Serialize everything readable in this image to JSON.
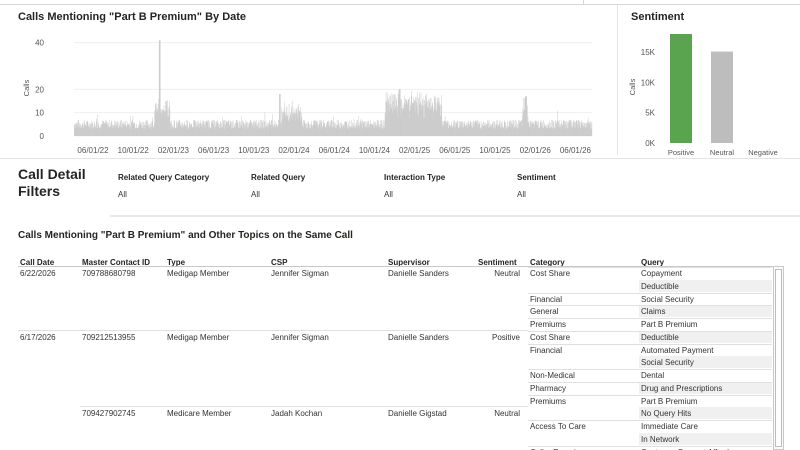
{
  "date_chart": {
    "title": "Calls Mentioning \"Part B Premium\" By Date",
    "ylabel": "Calls",
    "y_ticks": [
      "40",
      "20",
      "10",
      "0"
    ],
    "x_ticks": [
      "06/01/22",
      "10/01/22",
      "02/01/23",
      "06/01/23",
      "10/01/23",
      "02/01/24",
      "06/01/24",
      "10/01/24",
      "02/01/25",
      "06/01/25",
      "10/01/25",
      "02/01/26",
      "06/01/26"
    ],
    "bar_color": "#c8c8c8"
  },
  "chart_data": {
    "type": "bar",
    "title": "Sentiment",
    "categories": [
      "Positive",
      "Neutral",
      "Negative"
    ],
    "values": [
      18000,
      15100,
      0
    ],
    "colors": [
      "#5aa450",
      "#bdbdbd",
      "#bdbdbd"
    ],
    "ylabel": "Calls",
    "y_ticks": [
      "15K",
      "10K",
      "5K",
      "0K"
    ],
    "ylim": [
      0,
      18000
    ]
  },
  "filters": {
    "title": "Call Detail Filters",
    "items": [
      {
        "label": "Related Query Category",
        "value": "All"
      },
      {
        "label": "Related Query",
        "value": "All"
      },
      {
        "label": "Interaction Type",
        "value": "All"
      },
      {
        "label": "Sentiment",
        "value": "All"
      }
    ]
  },
  "table": {
    "title": "Calls Mentioning \"Part B Premium\" and Other Topics on the Same Call",
    "headers": [
      "Call Date",
      "Master Contact ID",
      "Type",
      "CSP",
      "Supervisor",
      "Sentiment",
      "Category",
      "Query"
    ],
    "rows": [
      {
        "date": "6/22/2026",
        "id": "709788680798",
        "type": "Medigap Member",
        "csp": "Jennifer Sigman",
        "supervisor": "Danielle Sanders",
        "sentiment": "Neutral"
      },
      {
        "date": "6/17/2026",
        "id": "709212513955",
        "type": "Medigap Member",
        "csp": "Jennifer Sigman",
        "supervisor": "Danielle Sanders",
        "sentiment": "Positive"
      },
      {
        "date": "",
        "id": "709427902745",
        "type": "Medicare Member",
        "csp": "Jadah Kochan",
        "supervisor": "Danielle Gigstad",
        "sentiment": "Neutral"
      }
    ],
    "subrows": [
      {
        "category": "Cost Share",
        "query": "Copayment"
      },
      {
        "category": "",
        "query": "Deductible"
      },
      {
        "category": "Financial",
        "query": "Social Security"
      },
      {
        "category": "General",
        "query": "Claims"
      },
      {
        "category": "Premiums",
        "query": "Part B Premium"
      },
      {
        "category": "Cost Share",
        "query": "Deductible"
      },
      {
        "category": "Financial",
        "query": "Automated Payment"
      },
      {
        "category": "",
        "query": "Social Security"
      },
      {
        "category": "Non-Medical",
        "query": "Dental"
      },
      {
        "category": "Pharmacy",
        "query": "Drug and Prescriptions"
      },
      {
        "category": "Premiums",
        "query": "Part B Premium"
      },
      {
        "category": "",
        "query": "No Query Hits"
      },
      {
        "category": "Access To Care",
        "query": "Immediate Care"
      },
      {
        "category": "",
        "query": "In Network"
      },
      {
        "category": "Caller Experience",
        "query": "Customer Support Afford"
      }
    ]
  }
}
